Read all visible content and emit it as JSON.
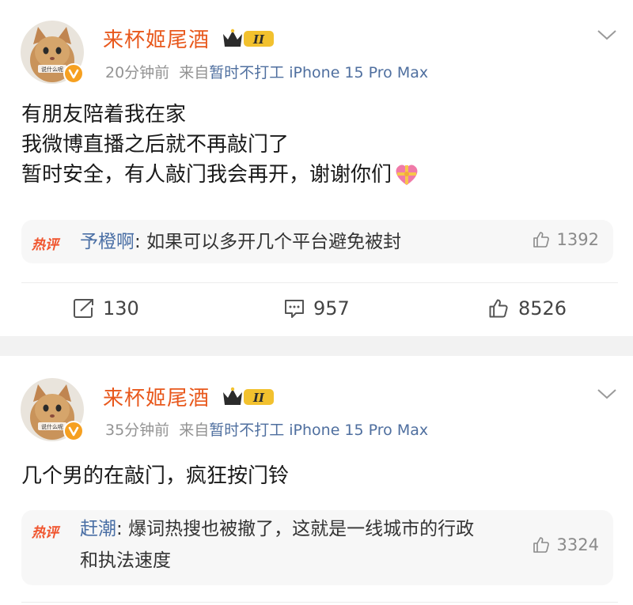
{
  "posts": [
    {
      "author": "来杯姬尾酒",
      "level_badge": "II",
      "time": "20分钟前",
      "source_prefix": "来自",
      "source": "暂时不打工 iPhone 15 Pro Max",
      "avatar_caption": "说什么呢",
      "lines": [
        "有朋友陪着我在家",
        "我微博直播之后就不再敲门了",
        "暂时安全，有人敲门我会再开，谢谢你们"
      ],
      "hot_comment": {
        "tag": "热评",
        "commenter": "予橙啊",
        "text": "如果可以多开几个平台避免被封",
        "likes": "1392"
      },
      "actions": {
        "reposts": "130",
        "comments": "957",
        "likes": "8526"
      }
    },
    {
      "author": "来杯姬尾酒",
      "level_badge": "II",
      "time": "35分钟前",
      "source_prefix": "来自",
      "source": "暂时不打工 iPhone 15 Pro Max",
      "avatar_caption": "说什么呢",
      "lines": [
        "几个男的在敲门，疯狂按门铃"
      ],
      "hot_comment": {
        "tag": "热评",
        "commenter": "赶潮",
        "text": "爆词热搜也被撤了，这就是一线城市的行政和执法速度",
        "likes": "3324"
      }
    }
  ],
  "colors": {
    "username": "#e8581c",
    "link": "#4f6f9f",
    "hot_tag": "#f0542d",
    "meta": "#939393"
  },
  "icons": [
    "chevron-down-icon",
    "repost-icon",
    "comment-icon",
    "like-icon",
    "verified-icon",
    "heart-gift-emoji"
  ]
}
